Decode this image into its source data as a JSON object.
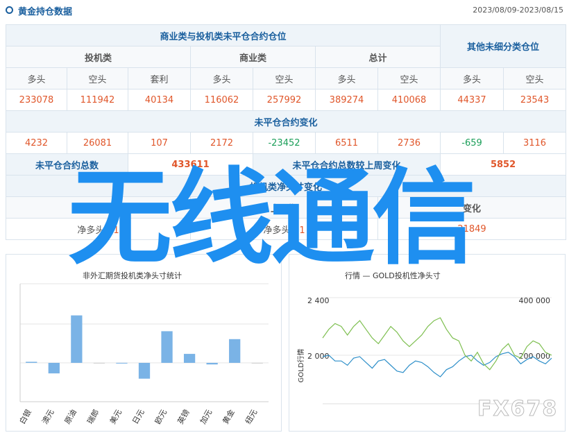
{
  "header": {
    "title": "黄金持仓数据",
    "date_range": "2023/08/09-2023/08/15"
  },
  "table": {
    "group_noncommercial": "商业类与投机类未平仓合约仓位",
    "group_other": "其他未细分类仓位",
    "col_speculative": "投机类",
    "col_commercial": "商业类",
    "col_total": "总计",
    "long": "多头",
    "short": "空头",
    "spread": "套利",
    "positions": [
      "233078",
      "111942",
      "40134",
      "116062",
      "257992",
      "389274",
      "410068",
      "44337",
      "23543"
    ],
    "change_title": "未平仓合约变化",
    "changes": [
      "4232",
      "26081",
      "107",
      "2172",
      "-23452",
      "6511",
      "2736",
      "-659",
      "3116"
    ],
    "oi_total_label": "未平仓合约总数",
    "oi_total": "433611",
    "oi_change_label": "未平仓合约总数较上周变化",
    "oi_change": "5852",
    "net_title": "投机类净头寸变化",
    "latest": "最新",
    "prev": "上一期",
    "change": "变化",
    "net_long_label": "净多头：",
    "net_long_latest": "1",
    "net_long_prev": "1",
    "net_change": "21849"
  },
  "left_chart_title": "非外汇期货投机类净头寸统计",
  "right_chart_title": "行情 — GOLD投机性净头寸",
  "watermark": "无线通信",
  "logo": "FX678",
  "colors": {
    "primary": "#1a5f9e",
    "positive": "#e0562a",
    "negative": "#1b9e59",
    "bar": "#7ab3e6",
    "gold_line": "#2e8fc9",
    "net_line": "#7ebf50"
  },
  "chart_data": [
    {
      "type": "bar",
      "title": "非外汇期货投机类净头寸统计",
      "categories": [
        "白银",
        "澳元",
        "原油",
        "瑞郎",
        "美元",
        "日元",
        "欧元",
        "英镑",
        "加元",
        "黄金",
        "纽元"
      ],
      "values": [
        2,
        -20,
        90,
        0,
        -1,
        -30,
        60,
        17,
        -3,
        45,
        0
      ],
      "grid": true
    },
    {
      "type": "line",
      "title": "GOLD行情 / GOLD投机性净头寸",
      "ylabel": "GOLD行情",
      "y_left_ticks": [
        "2 400",
        "2 000"
      ],
      "y_right_ticks": [
        "400 000",
        "200 000"
      ],
      "series": [
        {
          "name": "GOLD行情",
          "values": [
            1990,
            2000,
            1960,
            1960,
            1930,
            1980,
            1990,
            1950,
            1910,
            1960,
            1970,
            1930,
            1890,
            1880,
            1930,
            1960,
            1950,
            1920,
            1880,
            1850,
            1900,
            1920,
            1960,
            1990,
            2000,
            1960,
            1930,
            1950,
            1990,
            2010,
            2020,
            1990,
            1940,
            1970,
            1990,
            1960,
            1940,
            1980
          ]
        },
        {
          "name": "GOLD投机性净头寸",
          "values": [
            260000,
            290000,
            310000,
            300000,
            270000,
            300000,
            320000,
            290000,
            260000,
            240000,
            270000,
            300000,
            280000,
            250000,
            230000,
            250000,
            270000,
            300000,
            320000,
            330000,
            290000,
            260000,
            250000,
            200000,
            180000,
            210000,
            170000,
            150000,
            180000,
            220000,
            240000,
            200000,
            190000,
            230000,
            250000,
            240000,
            210000,
            200000
          ]
        }
      ]
    }
  ]
}
